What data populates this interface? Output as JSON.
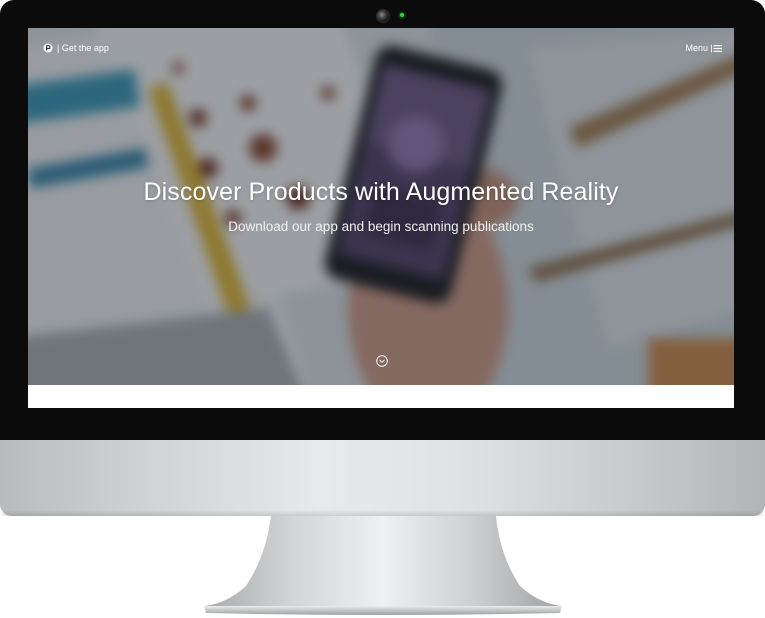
{
  "nav": {
    "brand_label": "| Get the app",
    "menu_label": "Menu",
    "logo_icon": "brand-logo-icon",
    "menu_icon": "hamburger-menu-icon"
  },
  "hero": {
    "title": "Discover Products with Augmented Reality",
    "subtitle": "Download our app and begin scanning publications",
    "scroll_icon": "chevron-down-circle-icon"
  },
  "device": {
    "camera_led_color": "#27d43a"
  }
}
